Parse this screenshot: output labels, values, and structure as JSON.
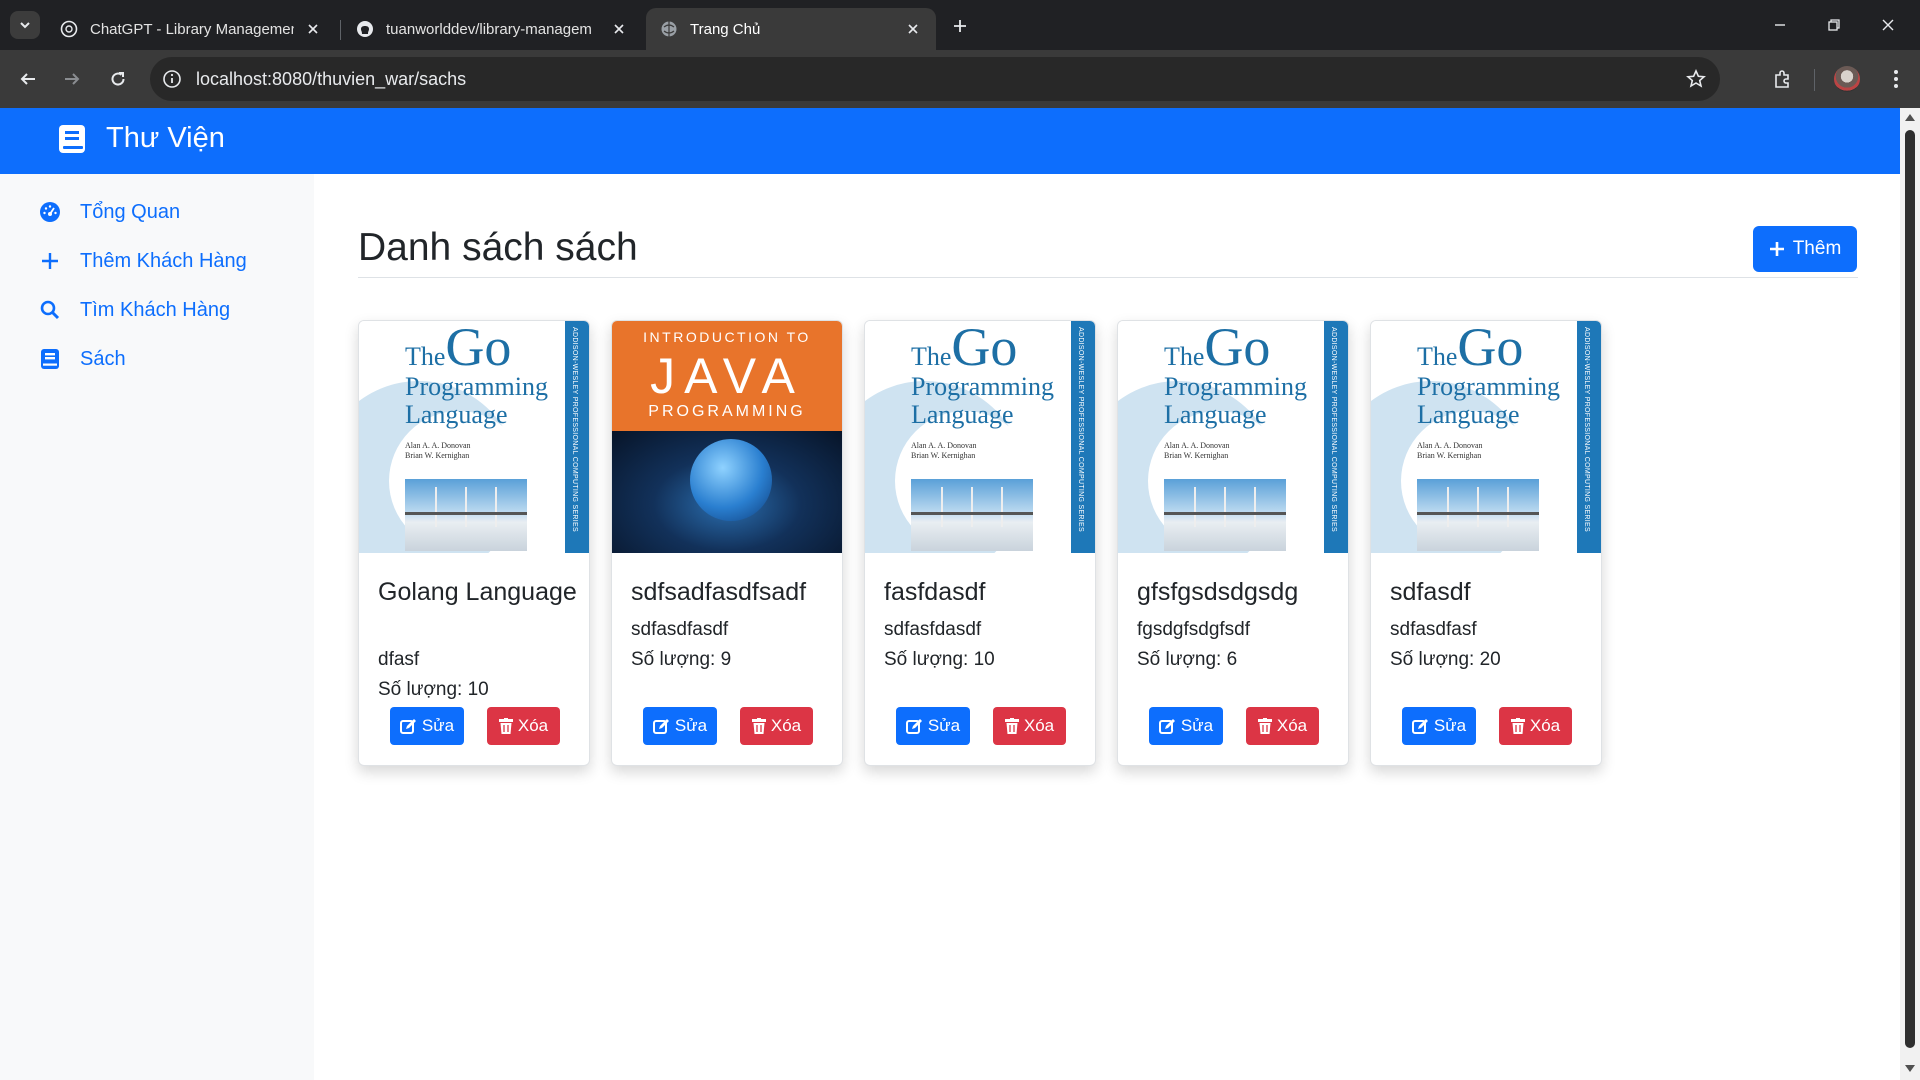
{
  "browser": {
    "tabs": [
      {
        "title": "ChatGPT - Library Management",
        "favicon": "chatgpt-icon",
        "active": false
      },
      {
        "title": "tuanworlddev/library-managem",
        "favicon": "github-icon",
        "active": false
      },
      {
        "title": "Trang Chủ",
        "favicon": "globe-icon",
        "active": true
      }
    ],
    "url": "localhost:8080/thuvien_war/sachs"
  },
  "navbar": {
    "brand": "Thư Viện",
    "brand_icon": "book-icon",
    "color": "#0d6efd"
  },
  "sidebar": {
    "items": [
      {
        "label": "Tổng Quan",
        "icon": "dashboard-gauge-icon"
      },
      {
        "label": "Thêm Khách Hàng",
        "icon": "plus-icon"
      },
      {
        "label": "Tìm Khách Hàng",
        "icon": "search-icon"
      },
      {
        "label": "Sách",
        "icon": "book-icon"
      }
    ]
  },
  "main": {
    "heading": "Danh sách sách",
    "add_button": "Thêm",
    "edit_label": "Sửa",
    "delete_label": "Xóa",
    "books": [
      {
        "title": "Golang Language",
        "author": "dfasf",
        "quantity": "Số lượng: 10",
        "cover": "go"
      },
      {
        "title": "sdfsadfasdfsadf",
        "author": "sdfasdfasdf",
        "quantity": "Số lượng: 9",
        "cover": "java"
      },
      {
        "title": "fasfdasdf",
        "author": "sdfasfdasdf",
        "quantity": "Số lượng: 10",
        "cover": "go"
      },
      {
        "title": "gfsfgsdsdgsdg",
        "author": "fgsdgfsdgfsdf",
        "quantity": "Số lượng: 6",
        "cover": "go"
      },
      {
        "title": "sdfasdf",
        "author": "sdfasdfasf",
        "quantity": "Số lượng: 20",
        "cover": "go"
      }
    ],
    "covers": {
      "go": {
        "title_the": "The",
        "title_go": "Go",
        "title_line2": "Programming",
        "title_line3": "Language",
        "authors": [
          "Alan A. A. Donovan",
          "Brian W. Kernighan"
        ],
        "spine": "ADDISON-WESLEY PROFESSIONAL COMPUTING SERIES"
      },
      "java": {
        "line1": "INTRODUCTION TO",
        "line2": "JAVA",
        "line3": "PROGRAMMING"
      }
    }
  }
}
